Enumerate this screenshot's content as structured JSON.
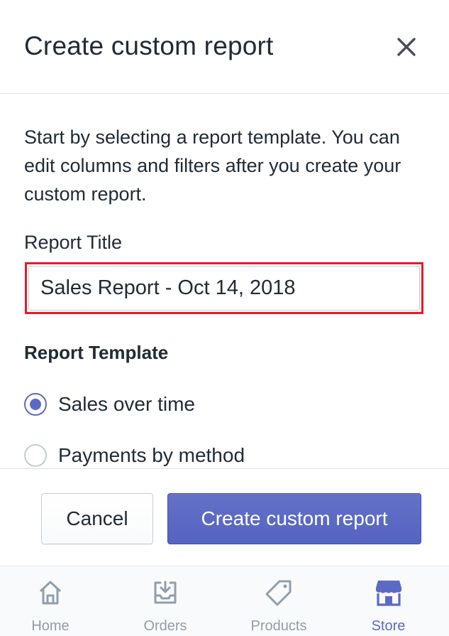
{
  "header": {
    "title": "Create custom report",
    "close_icon": "close-icon"
  },
  "intro": "Start by selecting a report template. You can edit columns and filters after you create your custom report.",
  "report_title": {
    "label": "Report Title",
    "value": "Sales Report - Oct 14, 2018",
    "highlight_color": "#e31c2c"
  },
  "report_template": {
    "heading": "Report Template",
    "options": [
      {
        "label": "Sales over time",
        "checked": true
      },
      {
        "label": "Payments by method",
        "checked": false
      }
    ]
  },
  "footer": {
    "cancel_label": "Cancel",
    "create_label": "Create custom report"
  },
  "tabbar": {
    "tabs": [
      {
        "label": "Home",
        "icon": "home-icon",
        "active": false
      },
      {
        "label": "Orders",
        "icon": "orders-icon",
        "active": false
      },
      {
        "label": "Products",
        "icon": "products-tag-icon",
        "active": false
      },
      {
        "label": "Store",
        "icon": "store-icon",
        "active": true
      }
    ]
  },
  "colors": {
    "accent": "#5c6ac4",
    "inactive_tab": "#919eab",
    "text": "#212b36"
  }
}
